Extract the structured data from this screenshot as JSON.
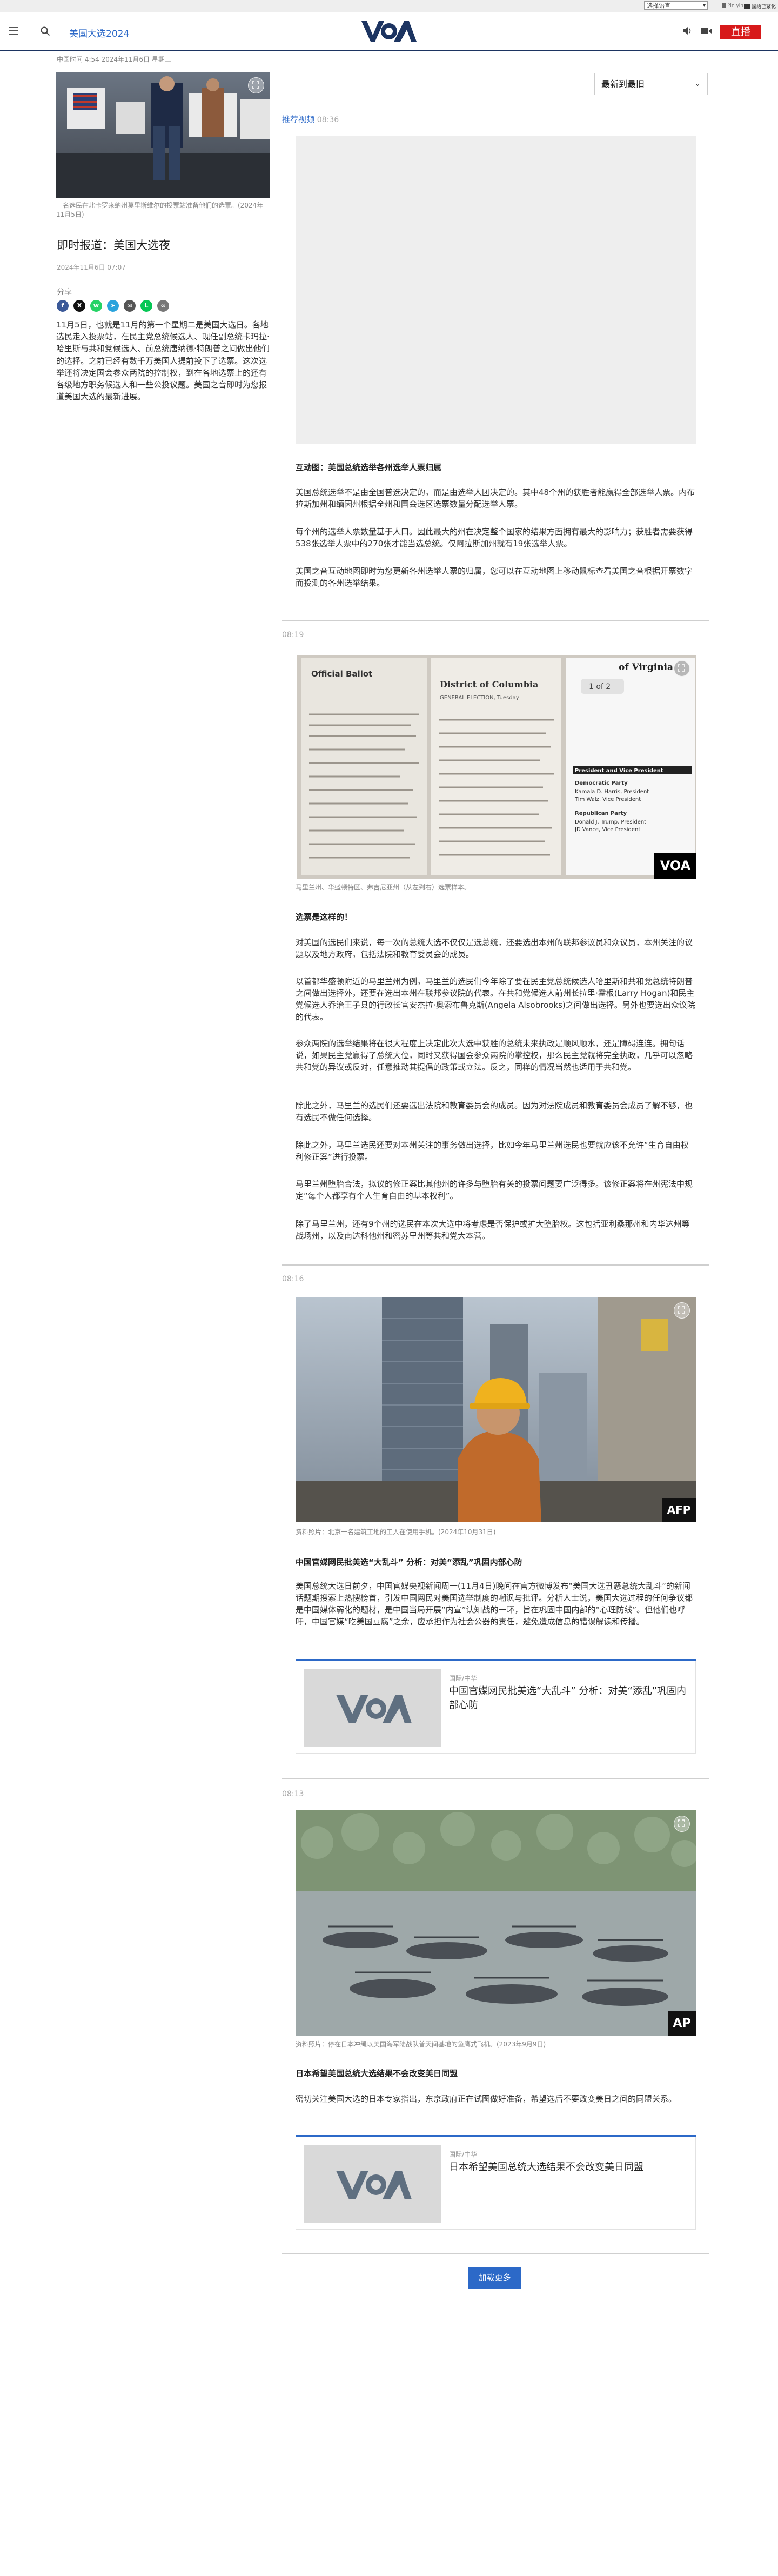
{
  "topstrip": {
    "language_select": "选择语言",
    "link_1": "Pin yin",
    "link_2": "國語已繁化"
  },
  "nav": {
    "section": "美国大选2024",
    "live": "直播"
  },
  "page": {
    "dateline": "中国时间 4:54 2024年11月6日 星期三",
    "image_caption": "一名选民在北卡罗来纳州莫里斯维尔的投票站准备他们的选票。(2024年11月5日)",
    "title": "即时报道：美国大选夜",
    "date": "2024年11月6日 07:07",
    "share_label": "分享",
    "body": "11月5日，也就是11月的第一个星期二是美国大选日。各地选民走入投票站，在民主党总统候选人、现任副总统卡玛拉·哈里斯与共和党候选人、前总统唐纳德·特朗普之间做出他们的选择。之前已经有数千万美国人提前投下了选票。这次选举还将决定国会参众两院的控制权，到在各地选票上的还有各级地方职务候选人和一些公投议题。美国之音即时为您报道美国大选的最新进展。"
  },
  "sort": {
    "label": "最新到最旧"
  },
  "posts": [
    {
      "label": "推荐视频",
      "time": "08:36",
      "title": "互动图：美国总统选举各州选举人票归属",
      "paragraphs": [
        "美国总统选举不是由全国普选决定的，而是由选举人团决定的。其中48个州的获胜者能赢得全部选举人票。内布拉斯加州和缅因州根据全州和国会选区选票数量分配选举人票。",
        "每个州的选举人票数量基于人口。因此最大的州在决定整个国家的结果方面拥有最大的影响力；获胜者需要获得538张选举人票中的270张才能当选总统。仅阿拉斯加州就有19张选举人票。",
        "美国之音互动地图即时为您更新各州选举人票的归属，您可以在互动地图上移动鼠标查看美国之音根据开票数字而投测的各州选举结果。"
      ]
    },
    {
      "time": "08:19",
      "caption": "马里兰州、华盛顿特区、弗吉尼亚州（从左到右）选票样本。",
      "title": "选票是这样的！",
      "paragraphs": [
        "对美国的选民们来说，每一次的总统大选不仅仅是选总统，还要选出本州的联邦参议员和众议员，本州关注的议题以及地方政府，包括法院和教育委员会的成员。",
        "以首都华盛顿附近的马里兰州为例，马里兰的选民们今年除了要在民主党总统候选人哈里斯和共和党总统特朗普之间做出选择外，还要在选出本州在联邦参议院的代表。在共和党候选人前州长拉里·霍根(Larry Hogan)和民主党候选人乔治王子县的行政长官安杰拉·奥索布鲁克斯(Angela Alsobrooks)之间做出选择。另外也要选出众议院的代表。",
        "参众两院的选举结果将在很大程度上决定此次大选中获胜的总统未来执政是顺风顺水，还是障碍连连。拥句话说，如果民主党赢得了总统大位，同时又获得国会参众两院的掌控权，那么民主党就将完全执政，几乎可以忽略共和党的异议或反对，任意推动其提倡的政策或立法。反之，同样的情况当然也适用于共和党。",
        "除此之外，马里兰的选民们还要选出法院和教育委员会的成员。因为对法院成员和教育委员会成员了解不够，也有选民不做任何选择。",
        "除此之外，马里兰选民还要对本州关注的事务做出选择，比如今年马里兰州选民也要就应该不允许“生育自由权利修正案”进行投票。",
        "马里兰州堕胎合法，拟议的修正案比其他州的许多与堕胎有关的投票问题要广泛得多。该修正案将在州宪法中规定“每个人都享有个人生育自由的基本权利”。",
        "除了马里兰州，还有9个州的选民在本次大选中将考虑是否保护或扩大堕胎权。这包括亚利桑那州和内华达州等战场州，以及南达科他州和密苏里州等共和党大本营。"
      ]
    },
    {
      "time": "08:16",
      "caption": "资料照片：北京一名建筑工地的工人在使用手机。(2024年10月31日)",
      "title": "中国官媒网民批美选“大乱斗” 分析：对美“添乱”巩固内部心防",
      "paragraphs": [
        "美国总统大选日前夕，中国官媒央视新闻周一(11月4日)晚间在官方微博发布“美国大选丑恶总统大乱斗”的新闻话题期搜索上热搜榜首，引发中国网民对美国选举制度的嘲讽与批评。分析人士说，美国大选过程的任何争议都是中国媒体弱化的题材，是中国当局开展“内宣”认知战的一环，旨在巩固中国内部的“心理防线”。但他们也呼吁，中国官媒“吃美国豆腐”之余，应承担作为社会公器的责任，避免造成信息的错误解读和传播。"
      ],
      "related": {
        "kicker": "国际/中华",
        "title": "中国官媒网民批美选“大乱斗” 分析：对美“添乱”巩固内部心防"
      }
    },
    {
      "time": "08:13",
      "caption": "资料照片：停在日本冲绳以美国海军陆战队普天间基地的鱼鹰式飞机。(2023年9月9日)",
      "title": "日本希望美国总统大选结果不会改变美日同盟",
      "paragraphs": [
        "密切关注美国大选的日本专家指出，东京政府正在试图做好准备，希望选后不要改变美日之间的同盟关系。"
      ],
      "related": {
        "kicker": "国际/中华",
        "title": "日本希望美国总统大选结果不会改变美日同盟"
      }
    }
  ],
  "badges": {
    "voa": "VOA",
    "afp": "AFP",
    "ap": "AP"
  },
  "ballot": {
    "heading": "of Virginia",
    "page_of": "1 of 2",
    "president_line": "President and Vice President",
    "party_1": "Democratic Party",
    "name_1": "Kamala D. Harris, President",
    "name_2": "Tim Walz, Vice President",
    "party_2": "Republican Party",
    "name_3": "Donald J. Trump, President",
    "name_4": "JD Vance, Vice President",
    "mid_title": "District of Columbia",
    "mid_sub": "GENERAL ELECTION, Tuesday",
    "left_title": "Official Ballot"
  },
  "load_more": "加载更多",
  "colors": {
    "accent": "#2c69c8",
    "brand": "#1c3461",
    "live": "#d7191a"
  }
}
